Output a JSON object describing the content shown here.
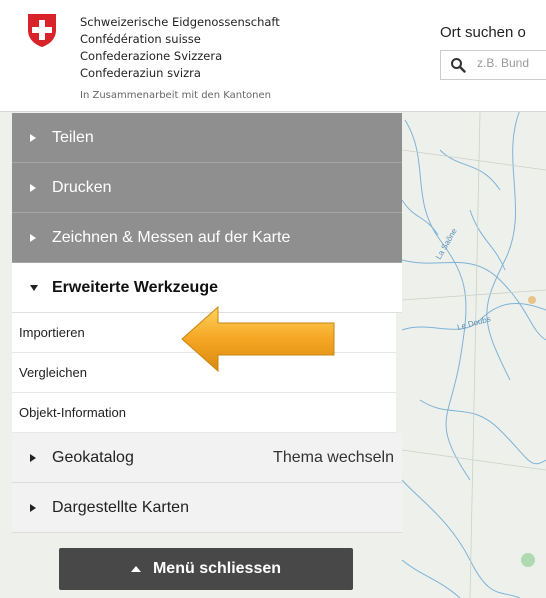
{
  "brand": {
    "lines": [
      "Schweizerische Eidgenossenschaft",
      "Confédération suisse",
      "Confederazione Svizzera",
      "Confederaziun svizra"
    ],
    "subtitle": "In Zusammenarbeit mit den Kantonen"
  },
  "search": {
    "title": "Ort suchen o",
    "placeholder": "z.B. Bund"
  },
  "map": {
    "labels": [
      "La Saône",
      "Le Doubs"
    ]
  },
  "menu": {
    "items": [
      {
        "label": "Teilen"
      },
      {
        "label": "Drucken"
      },
      {
        "label": "Zeichnen & Messen auf der Karte"
      },
      {
        "label": "Erweiterte Werkzeuge"
      },
      {
        "label": "Geokatalog",
        "right": "Thema wechseln"
      },
      {
        "label": "Dargestellte Karten"
      }
    ],
    "subitems": [
      "Importieren",
      "Vergleichen",
      "Objekt-Information"
    ],
    "close_label": "Menü schliessen"
  },
  "colors": {
    "menu_gray": "#8f8f8f",
    "arrow_orange": "#f5a623",
    "swiss_red": "#d8232a"
  }
}
